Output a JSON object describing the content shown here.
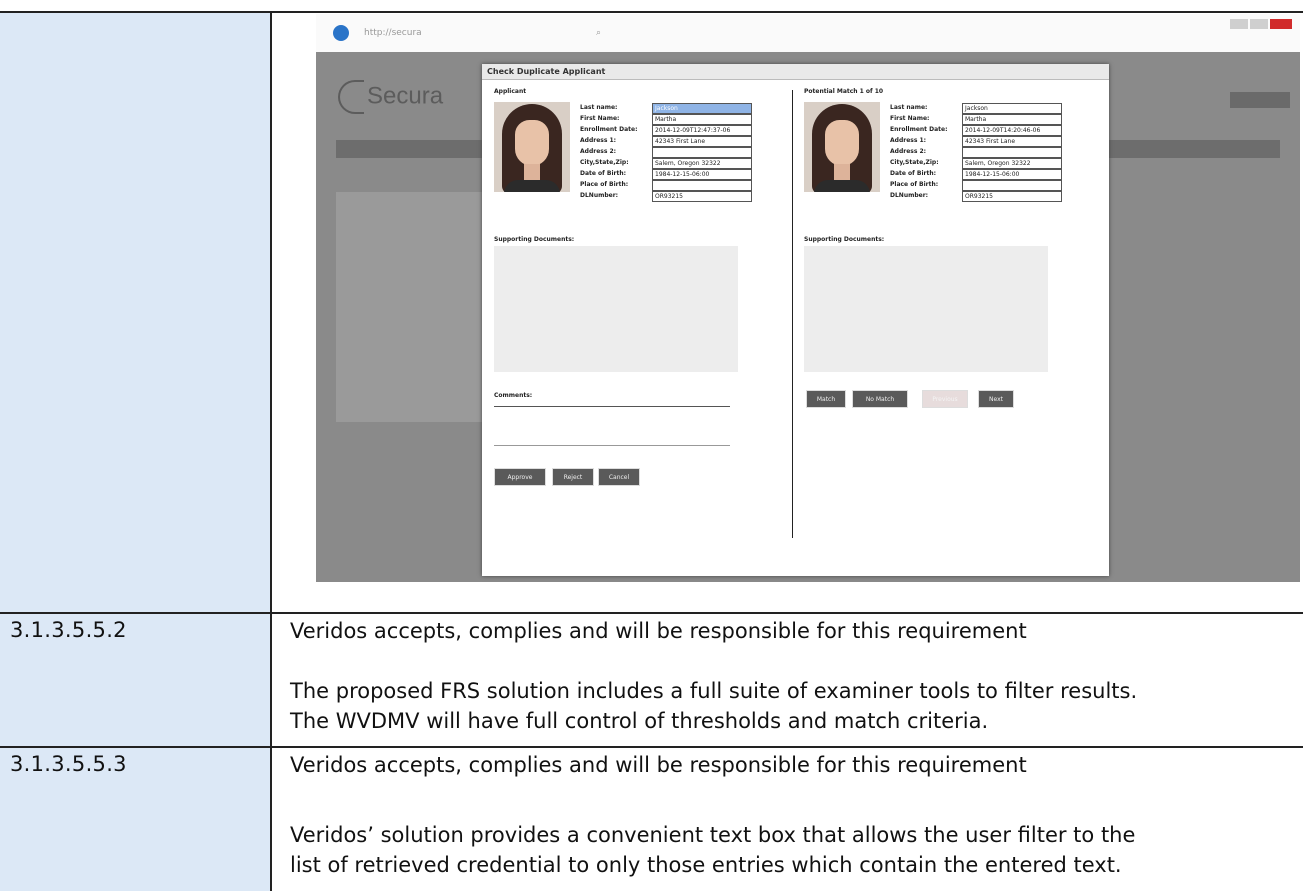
{
  "rows": [
    {
      "section": "3.1.3.5.5.2",
      "lines": [
        "Veridos accepts, complies and will be responsible for this requirement",
        "The proposed FRS solution includes a full suite of examiner tools to filter results.",
        "The WVDMV will have full control of thresholds and match criteria."
      ]
    },
    {
      "section": "3.1.3.5.5.3",
      "lines": [
        "Veridos accepts, complies and will be responsible for this requirement",
        "Veridos’ solution provides a convenient text box that allows the user filter to the",
        "list of retrieved credential to only those entries which contain the entered text."
      ]
    }
  ],
  "screenshot": {
    "app_logo": "Secura",
    "modal_title": "Check Duplicate Applicant",
    "applicant": {
      "heading": "Applicant",
      "fields": [
        {
          "label": "Last name:",
          "value": "Jackson"
        },
        {
          "label": "First Name:",
          "value": "Martha"
        },
        {
          "label": "Enrollment Date:",
          "value": "2014-12-09T12:47:37-06"
        },
        {
          "label": "Address 1:",
          "value": "42343 First Lane"
        },
        {
          "label": "Address 2:",
          "value": ""
        },
        {
          "label": "City,State,Zip:",
          "value": "Salem, Oregon 32322"
        },
        {
          "label": "Date of Birth:",
          "value": "1984-12-15-06:00"
        },
        {
          "label": "Place of Birth:",
          "value": ""
        },
        {
          "label": "DLNumber:",
          "value": "OR93215"
        }
      ],
      "supporting_docs": "Supporting Documents:",
      "comments": "Comments:",
      "buttons": [
        "Approve",
        "Reject",
        "Cancel"
      ]
    },
    "match": {
      "heading": "Potential Match 1 of 10",
      "fields": [
        {
          "label": "Last name:",
          "value": "Jackson"
        },
        {
          "label": "First Name:",
          "value": "Martha"
        },
        {
          "label": "Enrollment Date:",
          "value": "2014-12-09T14:20:46-06"
        },
        {
          "label": "Address 1:",
          "value": "42343 First Lane"
        },
        {
          "label": "Address 2:",
          "value": ""
        },
        {
          "label": "City,State,Zip:",
          "value": "Salem, Oregon 32322"
        },
        {
          "label": "Date of Birth:",
          "value": "1984-12-15-06:00"
        },
        {
          "label": "Place of Birth:",
          "value": ""
        },
        {
          "label": "DLNumber:",
          "value": "OR93215"
        }
      ],
      "supporting_docs": "Supporting Documents:",
      "buttons": [
        "Match",
        "No Match",
        "Previous",
        "Next"
      ]
    }
  }
}
